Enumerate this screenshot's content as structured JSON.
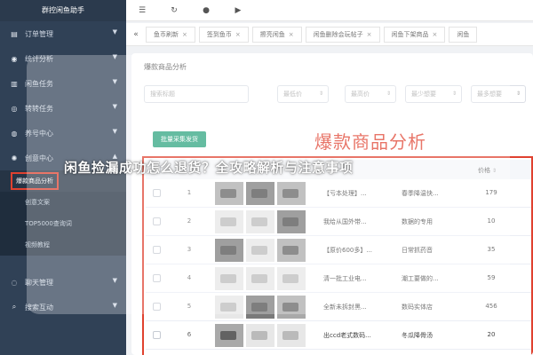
{
  "sidebar": {
    "title": "群控闲鱼助手",
    "items": [
      {
        "label": "订单管理",
        "icon": "document-icon"
      },
      {
        "label": "统计分析",
        "icon": "chart-icon"
      },
      {
        "label": "闲鱼任务",
        "icon": "task-icon"
      },
      {
        "label": "转转任务",
        "icon": "refresh-icon"
      },
      {
        "label": "养号中心",
        "icon": "user-icon"
      },
      {
        "label": "创意中心",
        "icon": "gear-icon"
      }
    ],
    "sub_items": [
      {
        "label": "爆款商品分析",
        "active": true
      },
      {
        "label": "创意文案"
      },
      {
        "label": "TOP5000查询词"
      },
      {
        "label": "视频教程"
      }
    ],
    "bottom_items": [
      {
        "label": "聊天管理",
        "icon": "chat-icon"
      },
      {
        "label": "搜索互动",
        "icon": "search-icon"
      }
    ]
  },
  "topbar": {
    "icons": [
      "menu-toggle-icon",
      "refresh-icon",
      "emoji-icon",
      "play-icon"
    ]
  },
  "tabs": [
    {
      "label": "鱼币刷新"
    },
    {
      "label": "签到鱼币"
    },
    {
      "label": "擦亮闲鱼"
    },
    {
      "label": "闲鱼删除会玩帖子"
    },
    {
      "label": "闲鱼下架商品"
    },
    {
      "label": "闲鱼"
    }
  ],
  "page": {
    "title": "爆款商品分析",
    "big_title": "爆款商品分析",
    "collect_button": "批量采集发货"
  },
  "filters": [
    {
      "placeholder": "搜索标题"
    },
    {
      "placeholder": "最低价"
    },
    {
      "placeholder": "最高价"
    },
    {
      "placeholder": "最少想要"
    },
    {
      "placeholder": "最多想要"
    }
  ],
  "table": {
    "price_header": "价格",
    "rows": [
      {
        "index": "1",
        "title": "【亏本处理】...",
        "desc": "春季降温快...",
        "price": "179",
        "thumbs": [
          "mid",
          "dark",
          "mid"
        ]
      },
      {
        "index": "2",
        "title": "我给从国外带...",
        "desc": "数据的专用",
        "price": "10",
        "thumbs": [
          "light",
          "light",
          "dark"
        ]
      },
      {
        "index": "3",
        "title": "【原价600多】...",
        "desc": "日常抓药音",
        "price": "35",
        "thumbs": [
          "dark",
          "light",
          "mid"
        ]
      },
      {
        "index": "4",
        "title": "清一批工业电...",
        "desc": "潮工要做的...",
        "price": "59",
        "thumbs": [
          "light",
          "light",
          "light"
        ]
      },
      {
        "index": "5",
        "title": "全新未拆封黑...",
        "desc": "数码实体店",
        "price": "456",
        "thumbs": [
          "light",
          "dark",
          "mid"
        ]
      },
      {
        "index": "6",
        "title": "出ccd老式数码...",
        "desc": "冬瓜降骨汤",
        "price": "20",
        "thumbs": [
          "mid",
          "light",
          "light"
        ]
      }
    ]
  },
  "overlay": {
    "text": "闲鱼捡漏成功怎么退货？全攻略解析与注意事项"
  },
  "colors": {
    "sidebar_bg": "#304156",
    "accent_red": "#e0412f",
    "button_green": "#2aa37d"
  }
}
